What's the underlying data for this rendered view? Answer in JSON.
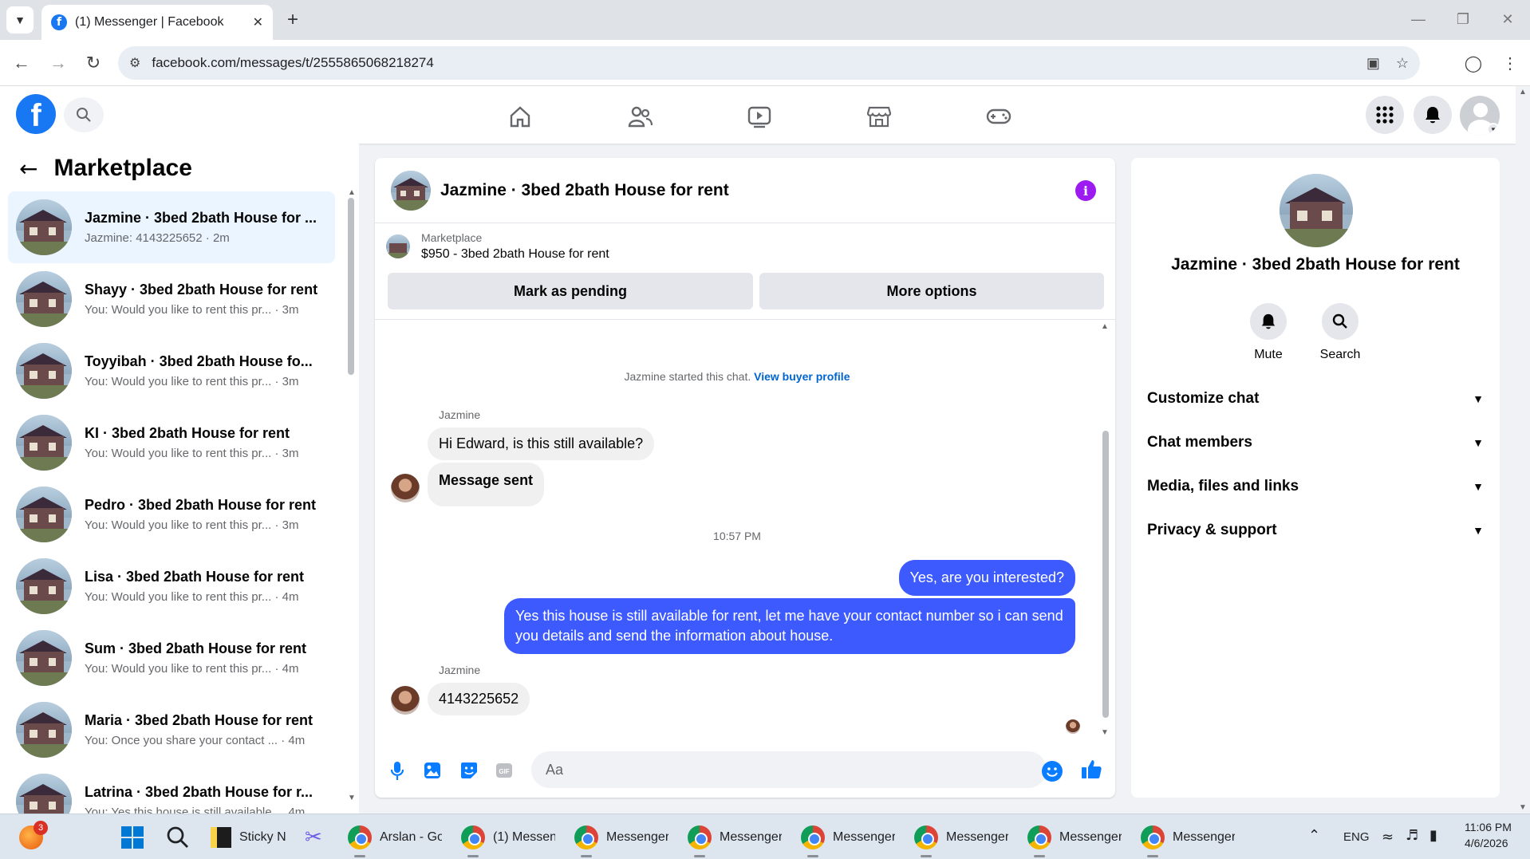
{
  "browser": {
    "tab_title": "(1) Messenger | Facebook",
    "url": "facebook.com/messages/t/2555865068218274"
  },
  "sidebar": {
    "title": "Marketplace",
    "conversations": [
      {
        "name": "Jazmine · 3bed 2bath House for ...",
        "preview": "Jazmine: 4143225652 · 2m",
        "active": true
      },
      {
        "name": "Shayy · 3bed 2bath House for rent",
        "preview": "You: Would you like to rent this pr... · 3m"
      },
      {
        "name": "Toyyibah · 3bed 2bath House fo...",
        "preview": "You: Would you like to rent this pr... · 3m"
      },
      {
        "name": "KI · 3bed 2bath House for rent",
        "preview": "You: Would you like to rent this pr... · 3m"
      },
      {
        "name": "Pedro · 3bed 2bath House for rent",
        "preview": "You: Would you like to rent this pr... · 3m"
      },
      {
        "name": "Lisa · 3bed 2bath House for rent",
        "preview": "You: Would you like to rent this pr... · 4m"
      },
      {
        "name": "Sum · 3bed 2bath House for rent",
        "preview": "You: Would you like to rent this pr... · 4m"
      },
      {
        "name": "Maria · 3bed 2bath House for rent",
        "preview": "You: Once you share your contact ... · 4m"
      },
      {
        "name": "Latrina · 3bed 2bath House for r...",
        "preview": "You: Yes this house is still available ... 4m"
      }
    ]
  },
  "chat": {
    "title": "Jazmine · 3bed 2bath House for rent",
    "marketplace_label": "Marketplace",
    "listing": "$950 - 3bed 2bath House for rent",
    "mark_pending_label": "Mark as pending",
    "more_options_label": "More options",
    "started_note": "Jazmine started this chat.",
    "view_profile_label": "View buyer profile",
    "sender_name": "Jazmine",
    "msg_in_1": "Hi Edward, is this still available?",
    "msg_in_2": "Message sent",
    "time_sep": "10:57 PM",
    "msg_out_1": "Yes, are you interested?",
    "msg_out_2": "Yes this house is still available for rent, let me have your contact number so i can send you details and send the information about house.",
    "msg_in_3": "4143225652",
    "composer_placeholder": "Aa"
  },
  "details": {
    "name": "Jazmine · 3bed 2bath House for rent",
    "mute_label": "Mute",
    "search_label": "Search",
    "sections": [
      "Customize chat",
      "Chat members",
      "Media, files and links",
      "Privacy & support"
    ]
  },
  "taskbar": {
    "badge": "3",
    "sticky_label": "Sticky N",
    "arslan_label": "Arslan - Go",
    "messenger1_label": "(1) Messeng",
    "messenger_label": "Messenger",
    "lang": "ENG",
    "time": "11:06 PM",
    "date": "4/6/2026"
  },
  "colors": {
    "fb_blue": "#1877f2",
    "outgoing_bubble": "#3d5afe",
    "info_purple": "#9b1bf0"
  }
}
